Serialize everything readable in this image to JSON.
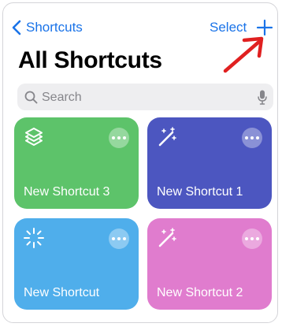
{
  "nav": {
    "back_label": "Shortcuts",
    "select_label": "Select",
    "accent_color": "#1a73e8"
  },
  "page_title": "All Shortcuts",
  "search": {
    "placeholder": "Search",
    "value": ""
  },
  "shortcuts": [
    {
      "label": "New Shortcut 3",
      "color": "#5dc36a",
      "icon": "layers-icon"
    },
    {
      "label": "New Shortcut 1",
      "color": "#4c56c0",
      "icon": "magic-wand-icon"
    },
    {
      "label": "New Shortcut",
      "color": "#4faeeb",
      "icon": "sparkle-wand-icon"
    },
    {
      "label": "New Shortcut 2",
      "color": "#e07cce",
      "icon": "magic-wand-icon"
    }
  ],
  "annotation": {
    "color": "#e02020",
    "icon": "red-arrow-icon"
  }
}
